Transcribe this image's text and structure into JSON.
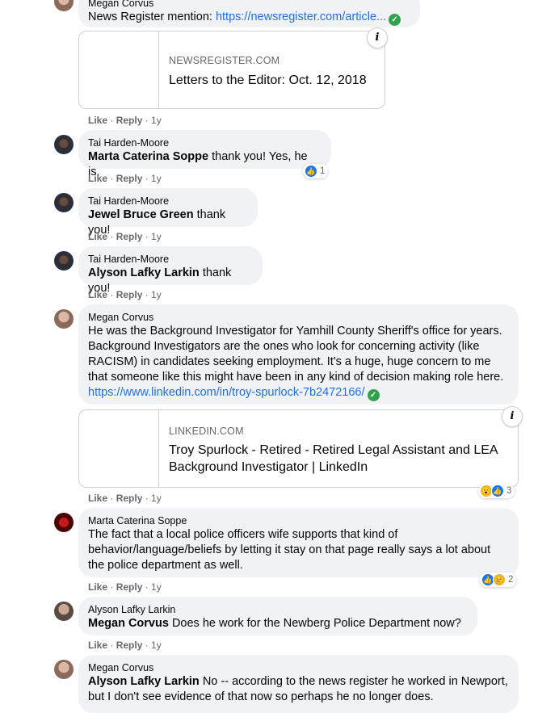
{
  "comments": [
    {
      "author": "Megan Corvus",
      "text": "News Register mention: ",
      "link": "https://newsregister.com/article...",
      "actions": {
        "like": "Like",
        "reply": "Reply",
        "time": "1y"
      },
      "card": {
        "domain": "NEWSREGISTER.COM",
        "title": "Letters to the Editor: Oct. 12, 2018"
      }
    },
    {
      "author": "Tai Harden-Moore",
      "mention": "Marta Caterina Soppe",
      "text": " thank you! Yes, he is.",
      "reaction_count": "1",
      "actions": {
        "like": "Like",
        "reply": "Reply",
        "time": "1y"
      }
    },
    {
      "author": "Tai Harden-Moore",
      "mention": "Jewel Bruce Green",
      "text": " thank you!",
      "actions": {
        "like": "Like",
        "reply": "Reply",
        "time": "1y"
      }
    },
    {
      "author": "Tai Harden-Moore",
      "mention": "Alyson Lafky Larkin",
      "text": " thank you!",
      "actions": {
        "like": "Like",
        "reply": "Reply",
        "time": "1y"
      }
    },
    {
      "author": "Megan Corvus",
      "text": "He was the Background Investigator for Yamhill County Sheriff's office for years. Background Investigators are the ones who look for concerning activity (like RACISM) in candidates seeking employment. It's a huge, huge concern to me that someone like this might have been in any kind of decision making role here. ",
      "link": "https://www.linkedin.com/in/troy-spurlock-7b2472166/",
      "reaction_count": "3",
      "actions": {
        "like": "Like",
        "reply": "Reply",
        "time": "1y"
      },
      "card": {
        "domain": "LINKEDIN.COM",
        "title": "Troy Spurlock - Retired - Retired Legal Assistant and LEA Background Investigator | LinkedIn"
      }
    },
    {
      "author": "Marta Caterina Soppe",
      "text": "The fact that a local police officers wife supports that kind of behavior/language/beliefs by letting it stay on that page really says a lot about the police department as well.",
      "reaction_count": "2",
      "actions": {
        "like": "Like",
        "reply": "Reply",
        "time": "1y"
      }
    },
    {
      "author": "Alyson Lafky Larkin",
      "mention": "Megan Corvus",
      "text": " Does he work for the Newberg Police Department now?",
      "actions": {
        "like": "Like",
        "reply": "Reply",
        "time": "1y"
      }
    },
    {
      "author": "Megan Corvus",
      "mention": "Alyson Lafky Larkin",
      "text": " No -- according to the news register he worked in Newport, but I don't see evidence of that now so perhaps he no longer does."
    }
  ],
  "icons": {
    "info": "i",
    "check": "✓"
  }
}
